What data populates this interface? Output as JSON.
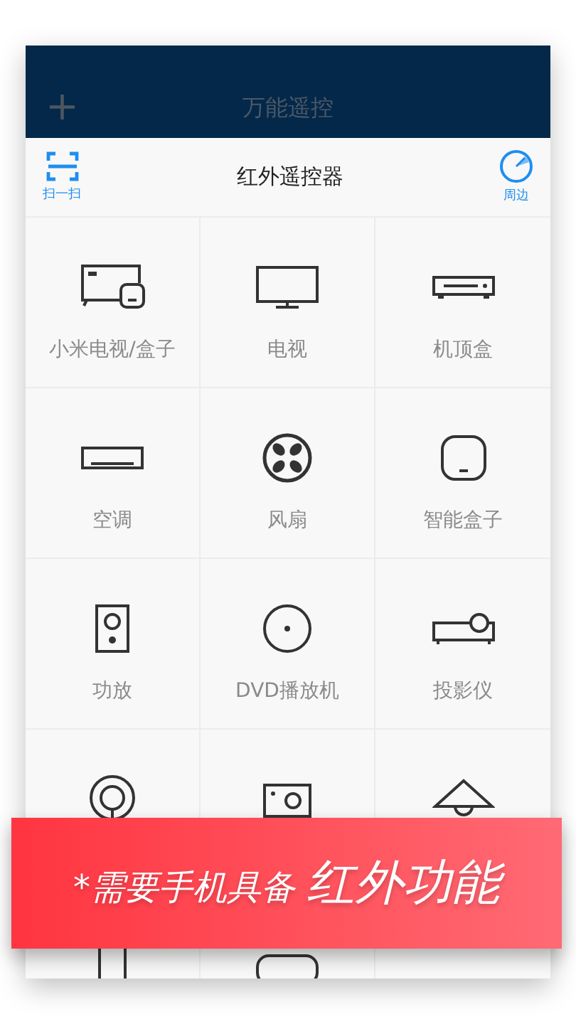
{
  "header": {
    "add_icon": "+",
    "title": "万能遥控"
  },
  "toolbar": {
    "scan_label": "扫一扫",
    "title": "红外遥控器",
    "nearby_label": "周边"
  },
  "devices": [
    {
      "kind": "mi-tv",
      "label": "小米电视/盒子"
    },
    {
      "kind": "tv",
      "label": "电视"
    },
    {
      "kind": "set-top-box",
      "label": "机顶盒"
    },
    {
      "kind": "air-conditioner",
      "label": "空调"
    },
    {
      "kind": "fan",
      "label": "风扇"
    },
    {
      "kind": "smart-box",
      "label": "智能盒子"
    },
    {
      "kind": "speaker",
      "label": "功放"
    },
    {
      "kind": "dvd",
      "label": "DVD播放机"
    },
    {
      "kind": "projector",
      "label": "投影仪"
    },
    {
      "kind": "round-device"
    },
    {
      "kind": "camera"
    },
    {
      "kind": "lamp"
    },
    {
      "kind": "tall-device"
    },
    {
      "kind": "rounded-device"
    },
    {
      "kind": "blank"
    }
  ],
  "banner": {
    "note": "*需要手机具备",
    "emphasis": "红外功能"
  }
}
